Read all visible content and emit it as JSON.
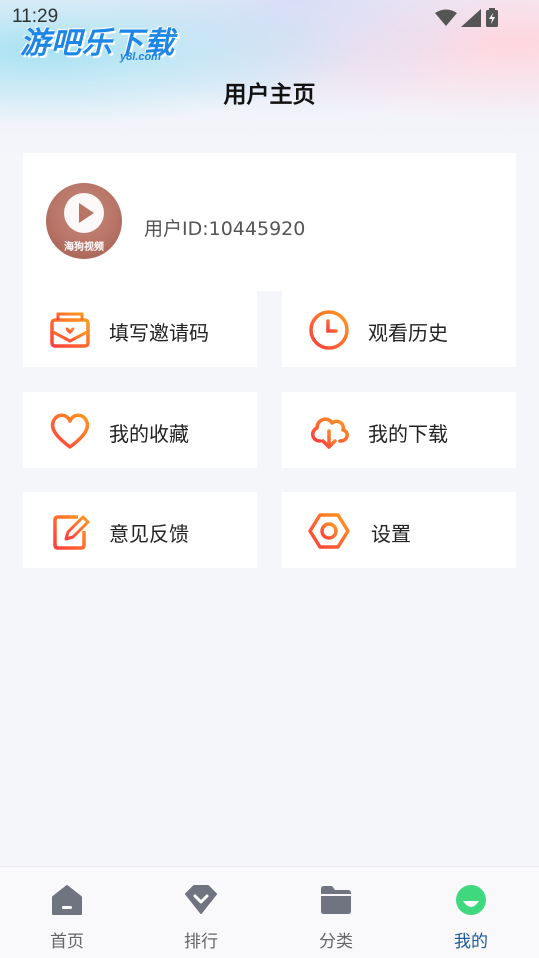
{
  "status_bar": {
    "time": "11:29"
  },
  "watermark": {
    "text": "游吧乐下载",
    "sub": "y8l.com"
  },
  "header": {
    "title": "用户主页"
  },
  "profile": {
    "avatar_label": "海狗视频",
    "user_id_text": "用户ID:10445920"
  },
  "menu": {
    "invite": "填写邀请码",
    "history": "观看历史",
    "favorites": "我的收藏",
    "downloads": "我的下载",
    "feedback": "意见反馈",
    "settings": "设置"
  },
  "tabbar": {
    "tabs": [
      {
        "label": "首页",
        "icon": "home-icon"
      },
      {
        "label": "排行",
        "icon": "ranking-icon"
      },
      {
        "label": "分类",
        "icon": "folder-icon"
      },
      {
        "label": "我的",
        "icon": "profile-icon"
      }
    ],
    "active_index": 3
  },
  "colors": {
    "accent_gradient_start": "#ff3d3d",
    "accent_gradient_end": "#ff9a1f",
    "active_tab": "#1c5a9c",
    "profile_icon_green": "#3fd87f"
  }
}
